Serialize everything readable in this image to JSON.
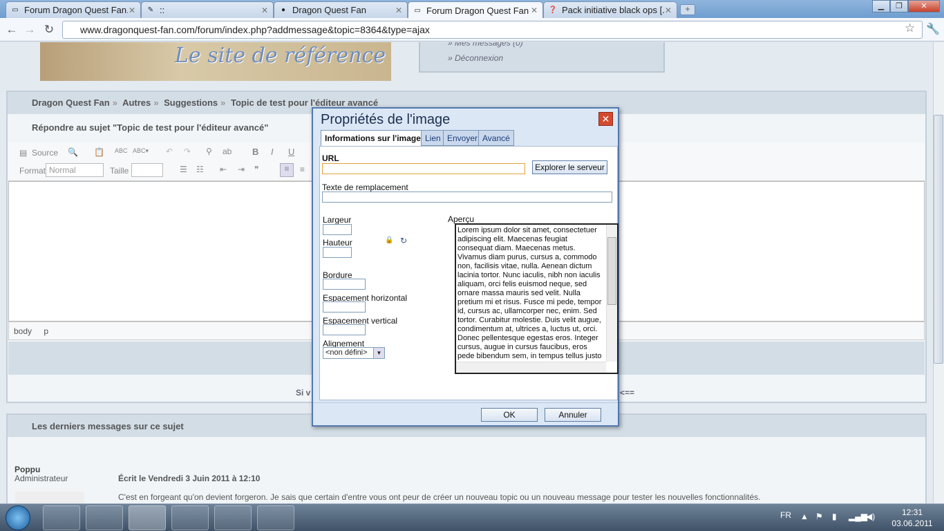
{
  "browser": {
    "tabs": [
      {
        "title": "Forum Dragon Quest Fan...",
        "favicon": "page-icon"
      },
      {
        "title": "::",
        "favicon": "puzzle-icon"
      },
      {
        "title": "Dragon Quest Fan",
        "favicon": "slime-icon"
      },
      {
        "title": "Forum Dragon Quest Fan",
        "favicon": "page-icon",
        "active": true
      },
      {
        "title": "Pack initiative black ops [...",
        "favicon": "question-icon"
      }
    ],
    "url": "www.dragonquest-fan.com/forum/index.php?addmessage&topic=8364&type=ajax"
  },
  "header": {
    "banner_text": "Le site de référence",
    "user_links": [
      "Mes messages (0)",
      "Déconnexion"
    ]
  },
  "breadcrumb": [
    "Dragon Quest Fan",
    "Autres",
    "Suggestions",
    "Topic de test pour l'éditeur avancé"
  ],
  "breadcrumb_sep": "»",
  "reply_title": "Répondre au sujet \"Topic de test pour l'éditeur avancé\"",
  "editor": {
    "source_label": "Source",
    "format_label": "Format",
    "format_value": "Normal",
    "size_label": "Taille",
    "path": [
      "body",
      "p"
    ]
  },
  "page_fragments": {
    "left": "Si v",
    "right": "<=="
  },
  "last_messages": {
    "heading": "Les derniers messages sur ce sujet",
    "author": "Poppu",
    "role": "Administrateur",
    "written": "Écrit le Vendredi 3 Juin 2011 à 12:10",
    "text": "C'est en forgeant qu'on devient forgeron. Je sais que certain d'entre vous ont peur de créer un nouveau topic ou un nouveau message pour tester les nouvelles fonctionnalités."
  },
  "dialog": {
    "title": "Propriétés de l'image",
    "tabs": [
      "Informations sur l'image",
      "Lien",
      "Envoyer",
      "Avancé"
    ],
    "url_label": "URL",
    "browse_button": "Explorer le serveur",
    "alt_label": "Texte de remplacement",
    "width_label": "Largeur",
    "height_label": "Hauteur",
    "border_label": "Bordure",
    "hspace_label": "Espacement horizontal",
    "vspace_label": "Espacement vertical",
    "align_label": "Alignement",
    "align_value": "<non défini>",
    "preview_label": "Aperçu",
    "preview_text": "Lorem ipsum dolor sit amet, consectetuer adipiscing elit. Maecenas feugiat consequat diam. Maecenas metus. Vivamus diam purus, cursus a, commodo non, facilisis vitae, nulla. Aenean dictum lacinia tortor. Nunc iaculis, nibh non iaculis aliquam, orci felis euismod neque, sed ornare massa mauris sed velit. Nulla pretium mi et risus. Fusce mi pede, tempor id, cursus ac, ullamcorper nec, enim. Sed tortor. Curabitur molestie. Duis velit augue, condimentum at, ultrices a, luctus ut, orci. Donec pellentesque egestas eros. Integer cursus, augue in cursus faucibus, eros pede bibendum sem, in tempus tellus justo quis ligula. Etiam eget tortor. Vestibulum",
    "ok_button": "OK",
    "cancel_button": "Annuler"
  },
  "taskbar": {
    "lang": "FR",
    "time": "12:31",
    "date": "03.06.2011"
  }
}
